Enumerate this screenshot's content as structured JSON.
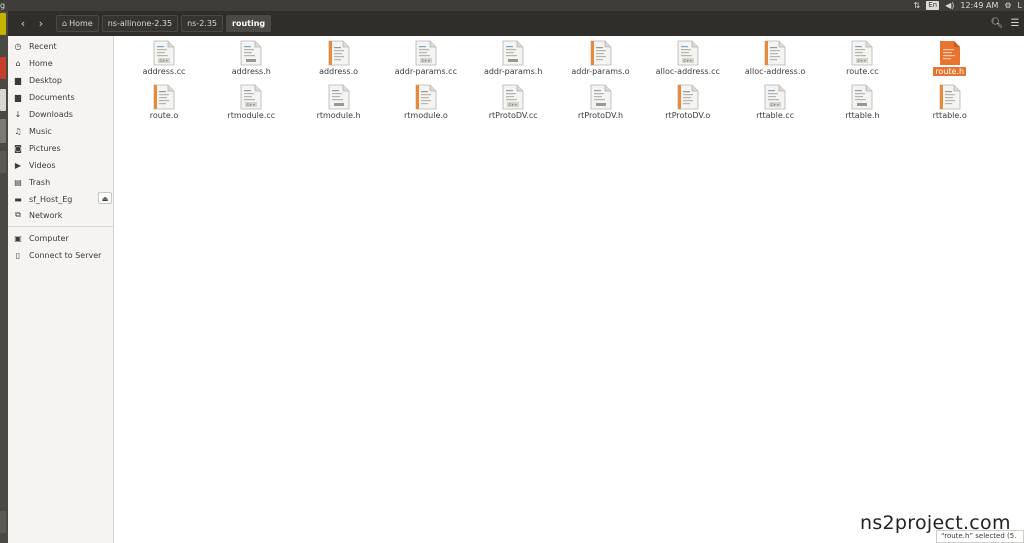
{
  "topbar": {
    "app_title": "g",
    "keyboard_layout": "En",
    "clock": "12:49 AM",
    "user_fragment": "L",
    "icons": [
      "network-arrows-icon",
      "keyboard-icon",
      "volume-icon",
      "settings-gear-icon"
    ]
  },
  "header": {
    "back_icon": "‹",
    "forward_icon": "›",
    "breadcrumb": [
      {
        "label": "Home",
        "icon": "home-icon"
      },
      {
        "label": "ns-allinone-2.35"
      },
      {
        "label": "ns-2.35"
      },
      {
        "label": "routing",
        "active": true
      }
    ],
    "search_icon": "search-icon",
    "menu_icon": "menu-icon"
  },
  "sidebar": {
    "items": [
      {
        "label": "Recent",
        "icon": "clock-icon"
      },
      {
        "label": "Home",
        "icon": "home-icon"
      },
      {
        "label": "Desktop",
        "icon": "folder-icon"
      },
      {
        "label": "Documents",
        "icon": "folder-icon"
      },
      {
        "label": "Downloads",
        "icon": "download-icon"
      },
      {
        "label": "Music",
        "icon": "music-icon"
      },
      {
        "label": "Pictures",
        "icon": "camera-icon"
      },
      {
        "label": "Videos",
        "icon": "video-icon"
      },
      {
        "label": "Trash",
        "icon": "trash-icon"
      },
      {
        "label": "sf_Host_Eg",
        "icon": "drive-icon"
      },
      {
        "label": "Network",
        "icon": "network-icon"
      },
      {
        "label": "Computer",
        "icon": "computer-icon"
      },
      {
        "label": "Connect to Server",
        "icon": "server-icon"
      }
    ],
    "eject_icon": "eject-icon"
  },
  "files": [
    {
      "name": "address.cc",
      "type": "cc"
    },
    {
      "name": "address.h",
      "type": "h"
    },
    {
      "name": "address.o",
      "type": "o"
    },
    {
      "name": "addr-params.cc",
      "type": "cc"
    },
    {
      "name": "addr-params.h",
      "type": "h"
    },
    {
      "name": "addr-params.o",
      "type": "o"
    },
    {
      "name": "alloc-address.cc",
      "type": "cc"
    },
    {
      "name": "alloc-address.o",
      "type": "o"
    },
    {
      "name": "route.cc",
      "type": "cc"
    },
    {
      "name": "route.h",
      "type": "h",
      "selected": true
    },
    {
      "name": "route.o",
      "type": "o"
    },
    {
      "name": "rtmodule.cc",
      "type": "cc"
    },
    {
      "name": "rtmodule.h",
      "type": "h"
    },
    {
      "name": "rtmodule.o",
      "type": "o"
    },
    {
      "name": "rtProtoDV.cc",
      "type": "cc"
    },
    {
      "name": "rtProtoDV.h",
      "type": "h"
    },
    {
      "name": "rtProtoDV.o",
      "type": "o"
    },
    {
      "name": "rttable.cc",
      "type": "cc"
    },
    {
      "name": "rttable.h",
      "type": "h"
    },
    {
      "name": "rttable.o",
      "type": "o"
    }
  ],
  "status": {
    "text": "“route.h” selected  (5."
  },
  "watermark": "ns2project.com",
  "colors": {
    "accent": "#e9742f",
    "header_bg": "#2f2e2b",
    "panel_bg": "#3e3d39",
    "sidebar_bg": "#f5f4f2"
  }
}
